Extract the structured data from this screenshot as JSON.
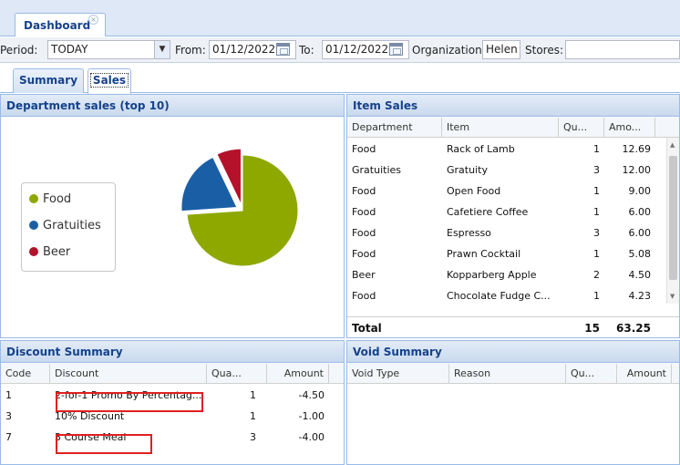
{
  "tabs": {
    "dashboard": "Dashboard",
    "close": "×"
  },
  "filter": {
    "period_label": "Period:",
    "period_value": "TODAY",
    "from_label": "From:",
    "from_value": "01/12/2022",
    "to_label": "To:",
    "to_value": "01/12/2022",
    "org_label": "Organization:",
    "org_value": "Helen",
    "stores_label": "Stores:",
    "stores_value": "",
    "dropdown_icon": "chevron-down-icon",
    "calendar_icon": "calendar-icon"
  },
  "subtabs": [
    {
      "label": "Summary",
      "active": false
    },
    {
      "label": "Sales",
      "active": true
    }
  ],
  "dept_panel": {
    "title": "Department sales (top 10)",
    "legend": [
      {
        "label": "Food",
        "color": "#8fa800"
      },
      {
        "label": "Gratuities",
        "color": "#1a5fa5"
      },
      {
        "label": "Beer",
        "color": "#b3122a"
      }
    ]
  },
  "chart_data": {
    "type": "pie",
    "title": "",
    "categories": [
      "Food",
      "Gratuities",
      "Beer"
    ],
    "values": [
      46.75,
      12.0,
      4.5
    ],
    "colors": [
      "#8fa800",
      "#1a5fa5",
      "#b3122a"
    ],
    "exploded": [
      false,
      true,
      true
    ],
    "legend_position": "left"
  },
  "item_sales": {
    "title": "Item Sales",
    "columns": [
      "Department",
      "Item",
      "Qu...",
      "Amo..."
    ],
    "rows": [
      [
        "Food",
        "Rack of Lamb",
        "1",
        "12.69"
      ],
      [
        "Gratuities",
        "Gratuity",
        "3",
        "12.00"
      ],
      [
        "Food",
        "Open Food",
        "1",
        "9.00"
      ],
      [
        "Food",
        "Cafetiere Coffee",
        "1",
        "6.00"
      ],
      [
        "Food",
        "Espresso",
        "3",
        "6.00"
      ],
      [
        "Food",
        "Prawn Cocktail",
        "1",
        "5.08"
      ],
      [
        "Beer",
        "Kopparberg Apple",
        "2",
        "4.50"
      ],
      [
        "Food",
        "Chocolate Fudge C...",
        "1",
        "4.23"
      ]
    ],
    "total_label": "Total",
    "total_qty": "15",
    "total_amount": "63.25"
  },
  "discount_summary": {
    "title": "Discount Summary",
    "columns": [
      "Code",
      "Discount",
      "Qua...",
      "Amount"
    ],
    "rows": [
      [
        "1",
        "2-for-1 Promo By Percentag...",
        "1",
        "-4.50"
      ],
      [
        "3",
        "10% Discount",
        "1",
        "-1.00"
      ],
      [
        "7",
        "3 Course Meal",
        "3",
        "-4.00"
      ]
    ]
  },
  "void_summary": {
    "title": "Void Summary",
    "columns": [
      "Void Type",
      "Reason",
      "Qu...",
      "Amount"
    ]
  }
}
